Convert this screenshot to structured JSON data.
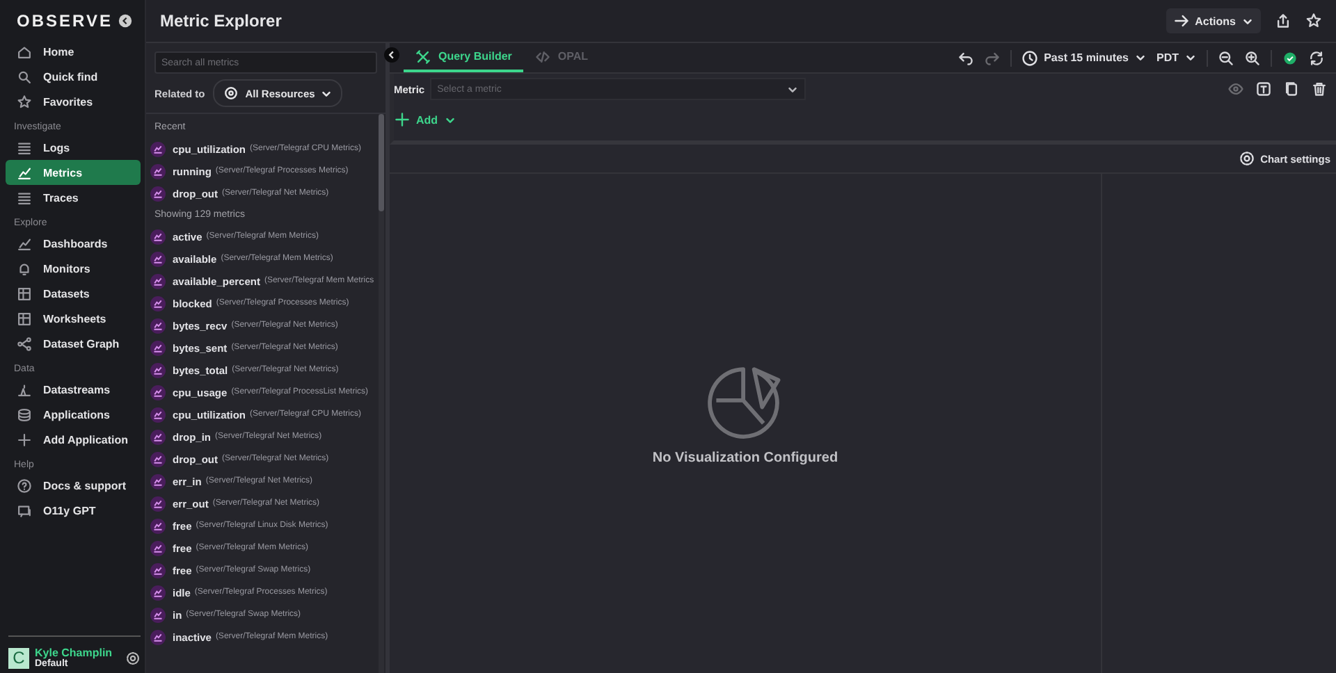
{
  "sidebar": {
    "logo": "OBSERVE",
    "sections": [
      {
        "items": [
          {
            "label": "Home",
            "selected": false
          },
          {
            "label": "Quick find",
            "selected": false
          },
          {
            "label": "Favorites",
            "selected": false
          }
        ]
      },
      {
        "title": "Investigate",
        "items": [
          {
            "label": "Logs",
            "selected": false
          },
          {
            "label": "Metrics",
            "selected": true
          },
          {
            "label": "Traces",
            "selected": false
          }
        ]
      },
      {
        "title": "Explore",
        "items": [
          {
            "label": "Dashboards",
            "selected": false
          },
          {
            "label": "Monitors",
            "selected": false
          },
          {
            "label": "Datasets",
            "selected": false
          },
          {
            "label": "Worksheets",
            "selected": false
          },
          {
            "label": "Dataset Graph",
            "selected": false
          }
        ]
      },
      {
        "title": "Data",
        "items": [
          {
            "label": "Datastreams",
            "selected": false
          },
          {
            "label": "Applications",
            "selected": false
          },
          {
            "label": "Add Application",
            "selected": false
          }
        ]
      },
      {
        "title": "Help",
        "items": [
          {
            "label": "Docs & support",
            "selected": false
          },
          {
            "label": "O11y GPT",
            "selected": false
          }
        ]
      }
    ],
    "user": {
      "initial": "C",
      "name": "Kyle Champlin",
      "workspace": "Default"
    }
  },
  "page_title": "Metric Explorer",
  "header_actions": {
    "actions": "Actions"
  },
  "metrics_panel": {
    "search": {
      "placeholder": "Search all metrics"
    },
    "related_label": "Related to",
    "related_value": "All Resources",
    "groups": [
      {
        "title": "Recent",
        "items": [
          {
            "name": "cpu_utilization",
            "source": "(Server/Telegraf CPU Metrics)"
          },
          {
            "name": "running",
            "source": "(Server/Telegraf Processes Metrics)"
          },
          {
            "name": "drop_out",
            "source": "(Server/Telegraf Net Metrics)"
          }
        ]
      },
      {
        "title": "Showing 129 metrics",
        "items": [
          {
            "name": "active",
            "source": "(Server/Telegraf Mem Metrics)"
          },
          {
            "name": "available",
            "source": "(Server/Telegraf Mem Metrics)"
          },
          {
            "name": "available_percent",
            "source": "(Server/Telegraf Mem Metrics"
          },
          {
            "name": "blocked",
            "source": "(Server/Telegraf Processes Metrics)"
          },
          {
            "name": "bytes_recv",
            "source": "(Server/Telegraf Net Metrics)"
          },
          {
            "name": "bytes_sent",
            "source": "(Server/Telegraf Net Metrics)"
          },
          {
            "name": "bytes_total",
            "source": "(Server/Telegraf Net Metrics)"
          },
          {
            "name": "cpu_usage",
            "source": "(Server/Telegraf ProcessList Metrics)"
          },
          {
            "name": "cpu_utilization",
            "source": "(Server/Telegraf CPU Metrics)"
          },
          {
            "name": "drop_in",
            "source": "(Server/Telegraf Net Metrics)"
          },
          {
            "name": "drop_out",
            "source": "(Server/Telegraf Net Metrics)"
          },
          {
            "name": "err_in",
            "source": "(Server/Telegraf Net Metrics)"
          },
          {
            "name": "err_out",
            "source": "(Server/Telegraf Net Metrics)"
          },
          {
            "name": "free",
            "source": "(Server/Telegraf Linux Disk Metrics)"
          },
          {
            "name": "free",
            "source": "(Server/Telegraf Mem Metrics)"
          },
          {
            "name": "free",
            "source": "(Server/Telegraf Swap Metrics)"
          },
          {
            "name": "idle",
            "source": "(Server/Telegraf Processes Metrics)"
          },
          {
            "name": "in",
            "source": "(Server/Telegraf Swap Metrics)"
          },
          {
            "name": "inactive",
            "source": "(Server/Telegraf Mem Metrics)"
          }
        ]
      }
    ]
  },
  "tabs": [
    {
      "label": "Query Builder",
      "selected": true
    },
    {
      "label": "OPAL",
      "selected": false
    }
  ],
  "toolbar": {
    "time_range": "Past 15 minutes",
    "timezone": "PDT"
  },
  "query": {
    "label": "Metric",
    "placeholder": "Select a metric",
    "add": "Add"
  },
  "chart": {
    "settings": "Chart settings",
    "empty_message": "No Visualization Configured"
  }
}
